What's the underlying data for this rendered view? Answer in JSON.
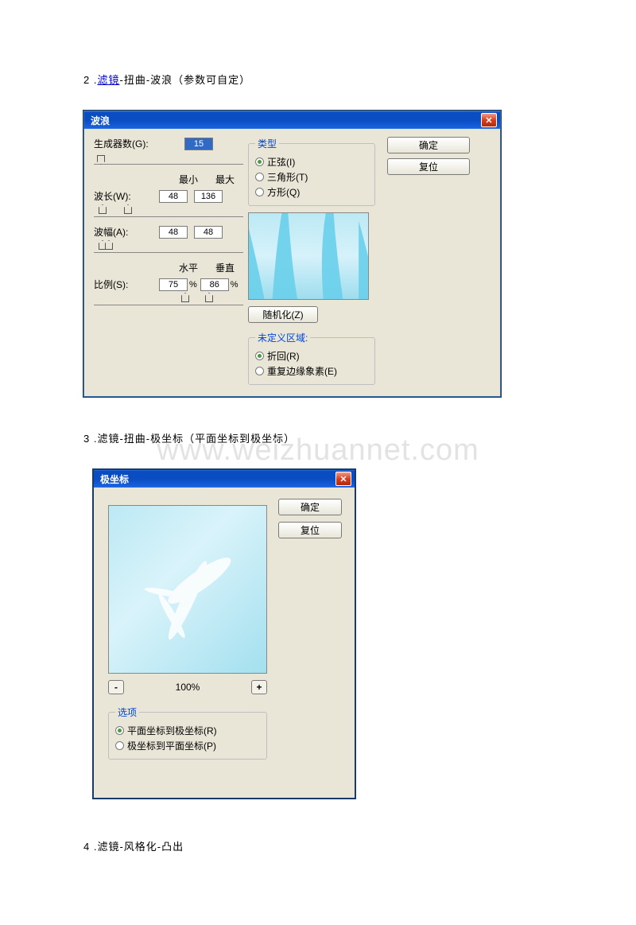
{
  "steps": {
    "s2_prefix": "2 .",
    "s2_link": "滤镜",
    "s2_rest": "-扭曲-波浪（参数可自定）",
    "s3": "3 .滤镜-扭曲-极坐标（平面坐标到极坐标）",
    "s4": "4 .滤镜-风格化-凸出"
  },
  "watermark": "www.weizhuannet.com",
  "wave": {
    "title": "波浪",
    "ok": "确定",
    "reset": "复位",
    "generators_label": "生成器数(G):",
    "generators_value": "15",
    "min": "最小",
    "max": "最大",
    "wavelength_label": "波长(W):",
    "wavelength_min": "48",
    "wavelength_max": "136",
    "amplitude_label": "波幅(A):",
    "amplitude_min": "48",
    "amplitude_max": "48",
    "horiz": "水平",
    "vert": "垂直",
    "scale_label": "比例(S):",
    "scale_h": "75",
    "scale_v": "86",
    "pct": "%",
    "type_legend": "类型",
    "type_sine": "正弦(I)",
    "type_tri": "三角形(T)",
    "type_square": "方形(Q)",
    "randomize": "随机化(Z)",
    "undef_legend": "未定义区域:",
    "undef_wrap": "折回(R)",
    "undef_repeat": "重复边缘象素(E)"
  },
  "polar": {
    "title": "极坐标",
    "ok": "确定",
    "reset": "复位",
    "zoom": "100%",
    "minus": "-",
    "plus": "+",
    "options_legend": "选项",
    "opt_rect_to_polar": "平面坐标到极坐标(R)",
    "opt_polar_to_rect": "极坐标到平面坐标(P)"
  }
}
